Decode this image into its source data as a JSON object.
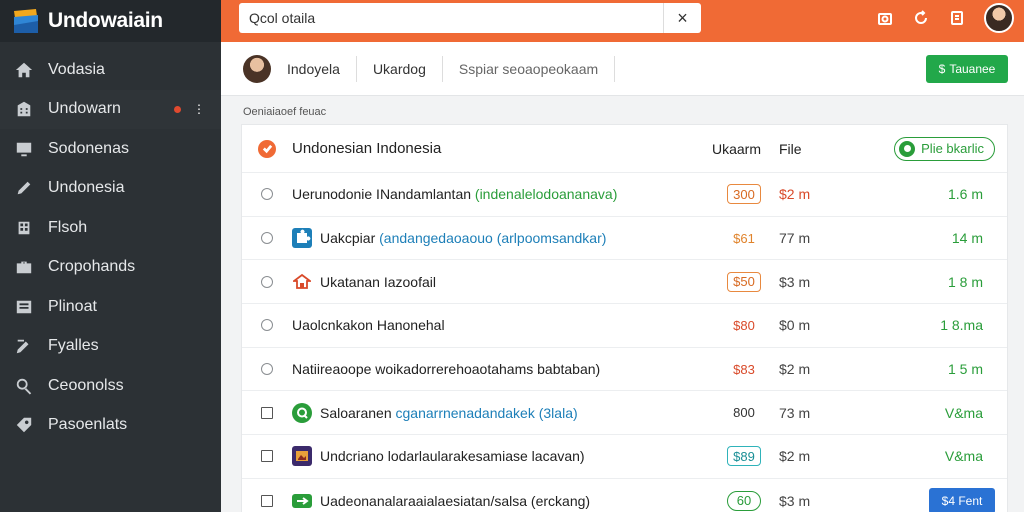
{
  "app": {
    "brand_name": "Undowaiain"
  },
  "sidebar": {
    "items": [
      {
        "label": "Vodasia",
        "icon": "home-icon"
      },
      {
        "label": "Undowarn",
        "icon": "building-icon"
      },
      {
        "label": "Sodonenas",
        "icon": "monitor-icon"
      },
      {
        "label": "Undonesia",
        "icon": "pencil-icon"
      },
      {
        "label": "Flsoh",
        "icon": "grid-icon"
      },
      {
        "label": "Cropohands",
        "icon": "briefcase-icon"
      },
      {
        "label": "Plinoat",
        "icon": "list-icon"
      },
      {
        "label": "Fyalles",
        "icon": "pen-icon"
      },
      {
        "label": "Ceoonolss",
        "icon": "search-icon"
      },
      {
        "label": "Pasoenlats",
        "icon": "tag-icon"
      }
    ]
  },
  "search": {
    "value": "Qcol otaila",
    "clear_label": "×"
  },
  "subheader": {
    "tab1": "Indoyela",
    "tab2": "Ukardog",
    "tab3": "Sspiar seoaopeokaam",
    "primary_button": "Tauanee"
  },
  "section_label": "Oeniaiaoef feuac",
  "table": {
    "header": {
      "name": "Undonesian Indonesia",
      "col_size": "Ukaarm",
      "col_file": "File",
      "action": "Plie bkarlic"
    },
    "rows": [
      {
        "control": "radio",
        "icon": "",
        "name": "Uerunodonie INandamlantan",
        "extra": "(indenalelodoananava)",
        "extra_color": "green",
        "size": "300",
        "size_style": "orange",
        "file": "$2 m",
        "file_style": "red",
        "value": "1.6 m"
      },
      {
        "control": "radio",
        "icon": "puzzle-icon",
        "name": "Uakcpiar",
        "extra": "(andangedaoaouo (arlpoomsandkar)",
        "extra_color": "blue",
        "size": "$61",
        "size_style": "plain-orange",
        "file": "77 m",
        "file_style": "",
        "value": "14 m"
      },
      {
        "control": "radio",
        "icon": "temple-icon",
        "name": "Ukatanan Iazoofail",
        "extra": "",
        "extra_color": "",
        "size": "$50",
        "size_style": "orange",
        "file": "$3 m",
        "file_style": "",
        "value": "1 8 m"
      },
      {
        "control": "radio",
        "icon": "",
        "name": "Uaolcnkakon Hanonehal",
        "extra": "",
        "extra_color": "",
        "size": "$80",
        "size_style": "red",
        "file": "$0 m",
        "file_style": "",
        "value": "1 8.ma"
      },
      {
        "control": "radio",
        "icon": "",
        "name": "Natiireaoope woikadorrerehoaotahams babtaban)",
        "extra": "",
        "extra_color": "",
        "size": "$83",
        "size_style": "red",
        "file": "$2 m",
        "file_style": "",
        "value": "1 5 m"
      },
      {
        "control": "checkbox",
        "icon": "chat-icon",
        "name": "Saloaranen",
        "extra": "cganarrnenadandakek (3lala)",
        "extra_color": "blue",
        "size": "800",
        "size_style": "dark",
        "file": "73 m",
        "file_style": "",
        "value": "V&ma"
      },
      {
        "control": "checkbox",
        "icon": "frame-icon",
        "name": "Undcriano lodarlaularakesamiase lacavan)",
        "extra": "",
        "extra_color": "",
        "size": "$89",
        "size_style": "teal",
        "file": "$2 m",
        "file_style": "",
        "value": "V&ma"
      },
      {
        "control": "checkbox",
        "icon": "flag-icon",
        "name": "Uadeonanalaraaialaesiatan/salsa (erckang)",
        "extra": "",
        "extra_color": "",
        "size": "60",
        "size_style": "green",
        "file": "$3 m",
        "file_style": "",
        "value": "",
        "button": "$4 Fent"
      }
    ]
  },
  "colors": {
    "topbar": "#f06a35",
    "sidebar": "#2c3135",
    "primary": "#22a84a",
    "link_blue": "#2a72d4"
  }
}
